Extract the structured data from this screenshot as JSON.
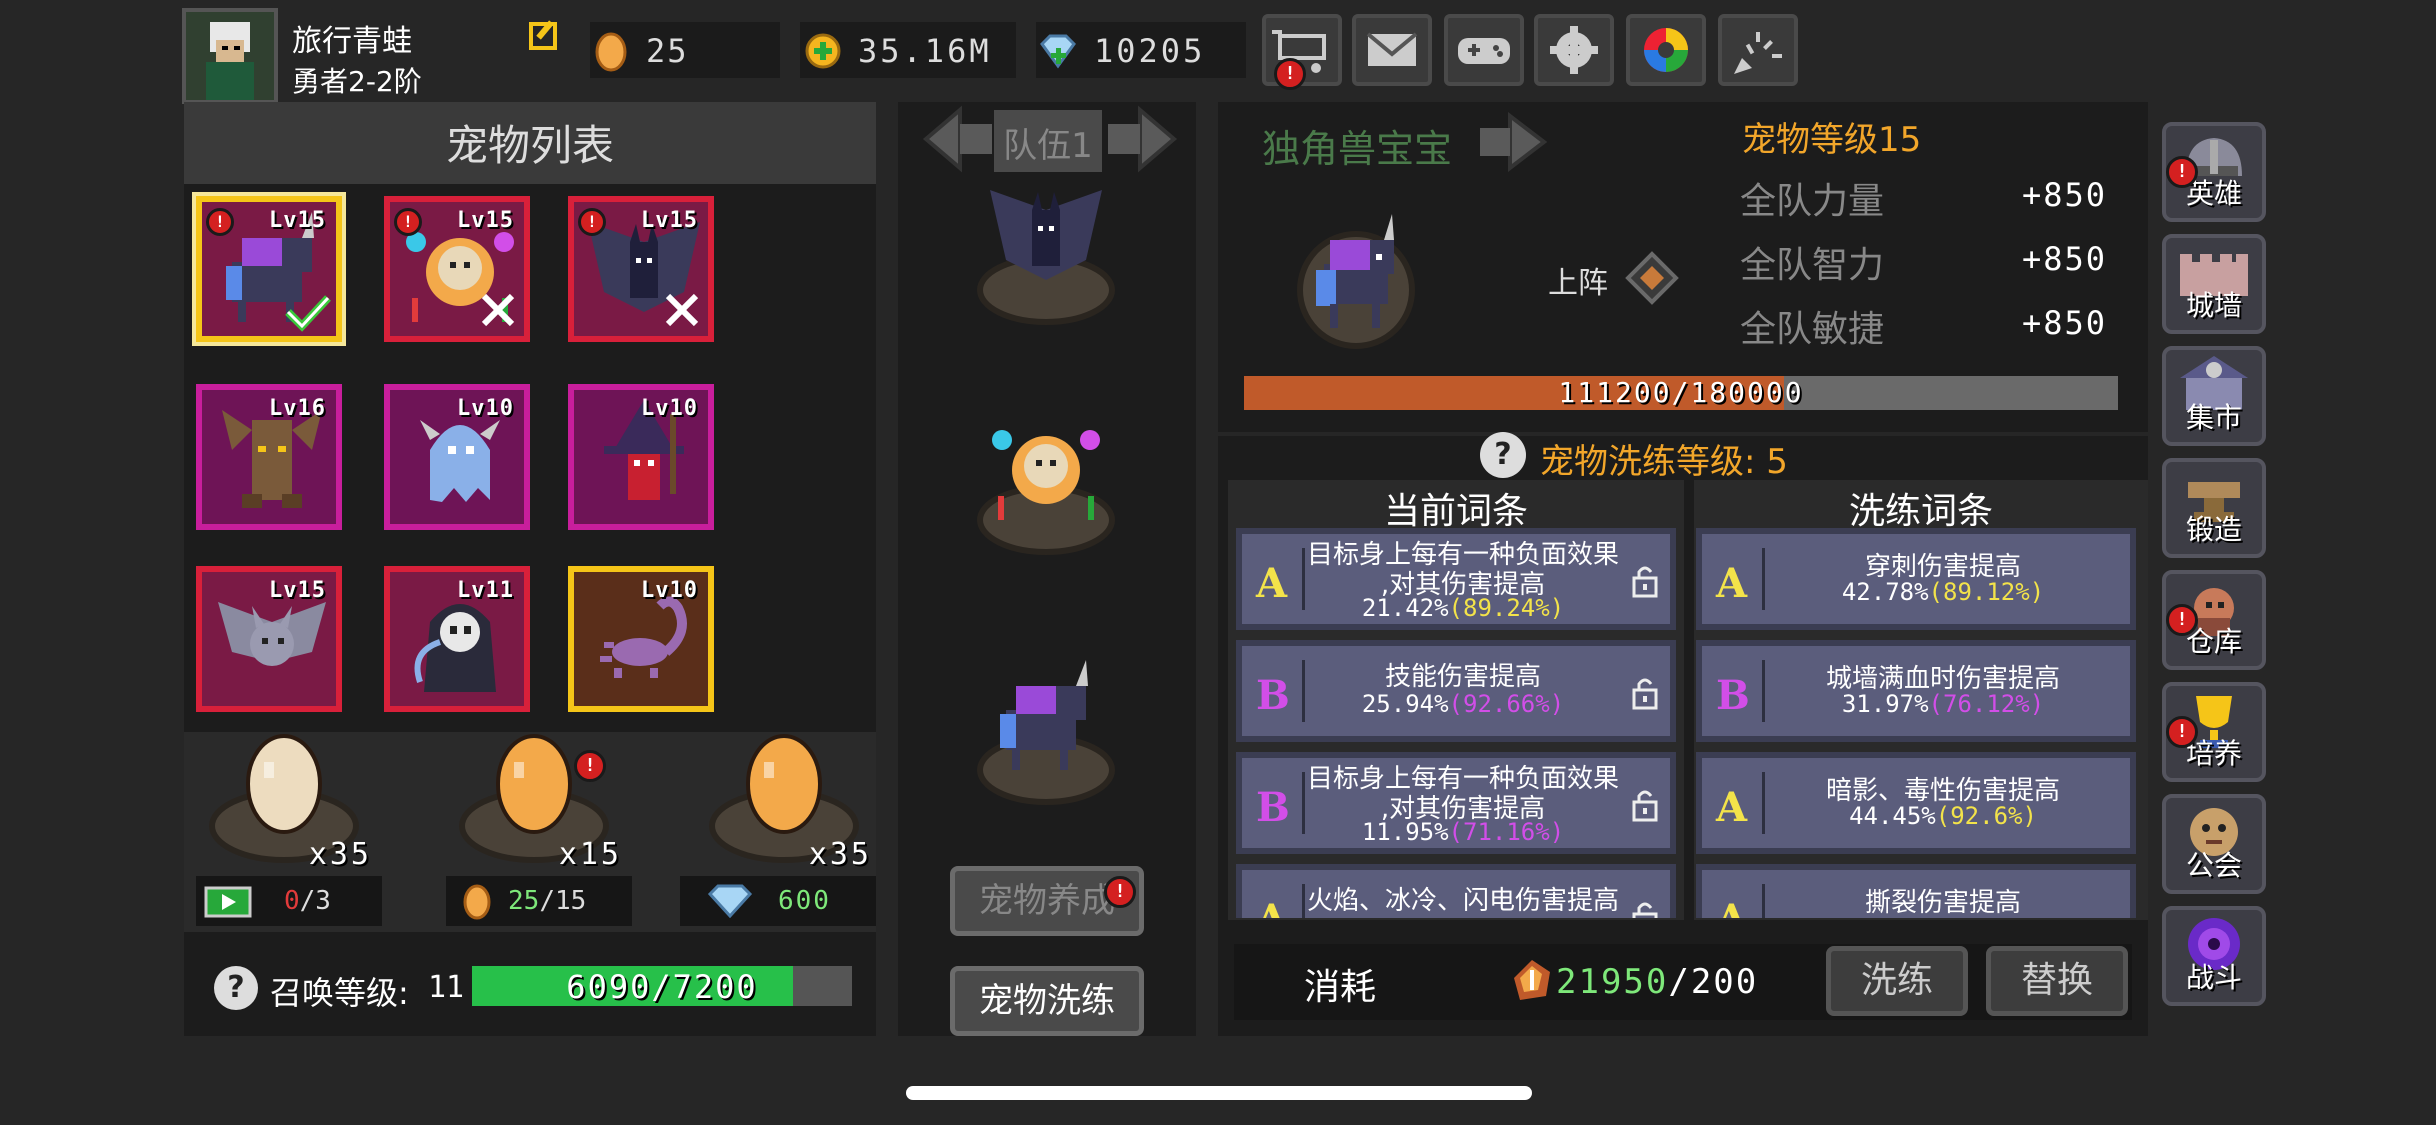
{
  "player": {
    "name": "旅行青蛙",
    "rank": "勇者2-2阶"
  },
  "currency": {
    "eggs": "25",
    "gold": "35.16M",
    "diamonds": "10205"
  },
  "top_icons": [
    "cart-icon",
    "mail-icon",
    "gamepad-icon",
    "settings-icon",
    "color-wheel-icon",
    "fireworks-icon"
  ],
  "pet_list": {
    "title": "宠物列表",
    "pets": [
      {
        "level": "Lv15",
        "name": "unicorn-pet",
        "border": "#f5c518",
        "bg": "#7a1a45",
        "alert": true,
        "state": "check"
      },
      {
        "level": "Lv15",
        "name": "fire-skull-pet",
        "border": "#d8203a",
        "bg": "#7a1a45",
        "alert": true,
        "state": "cross"
      },
      {
        "level": "Lv15",
        "name": "bat-demon-pet",
        "border": "#d8203a",
        "bg": "#7a1a45",
        "alert": true,
        "state": "cross"
      },
      {
        "level": "Lv16",
        "name": "treant-pet",
        "border": "#c81e9c",
        "bg": "#6e1456",
        "alert": false,
        "state": ""
      },
      {
        "level": "Lv10",
        "name": "ghost-pet",
        "border": "#c81e9c",
        "bg": "#6e1456",
        "alert": false,
        "state": ""
      },
      {
        "level": "Lv10",
        "name": "witch-pet",
        "border": "#c81e9c",
        "bg": "#6e1456",
        "alert": false,
        "state": ""
      },
      {
        "level": "Lv15",
        "name": "bat-pet",
        "border": "#d8203a",
        "bg": "#7a1a45",
        "alert": false,
        "state": ""
      },
      {
        "level": "Lv11",
        "name": "reaper-pet",
        "border": "#d8203a",
        "bg": "#7a1a45",
        "alert": false,
        "state": ""
      },
      {
        "level": "Lv10",
        "name": "scorpion-pet",
        "border": "#f5c518",
        "bg": "#5a2e1a",
        "alert": false,
        "state": ""
      }
    ]
  },
  "eggs": [
    {
      "count": "x35",
      "color": "#eddcbf"
    },
    {
      "count": "x15",
      "color": "#f3a94a",
      "alert": true
    },
    {
      "count": "x35",
      "color": "#f3a94a"
    }
  ],
  "costs": [
    {
      "value": "0",
      "max": "/3"
    },
    {
      "value": "25",
      "max": "/15"
    },
    {
      "value": "600",
      "max": ""
    }
  ],
  "summon": {
    "label": "召唤等级:",
    "level": "11",
    "progress": "6090/7200",
    "fraction": 0.8458
  },
  "team": {
    "title": "队伍1",
    "slots": [
      "bat-demon-pet",
      "fire-skull-pet",
      "unicorn-pet"
    ]
  },
  "team_buttons": {
    "raise": "宠物养成",
    "refine": "宠物洗练"
  },
  "pet_detail": {
    "name": "独角兽宝宝",
    "level_label": "宠物等级15",
    "deploy": "上阵",
    "stats": [
      {
        "label": "全队力量",
        "value": "+850"
      },
      {
        "label": "全队智力",
        "value": "+850"
      },
      {
        "label": "全队敏捷",
        "value": "+850"
      }
    ],
    "exp": "111200/180000",
    "exp_fraction": 0.6178
  },
  "refine": {
    "level_label": "宠物洗练等级:",
    "level": "5",
    "current_title": "当前词条",
    "refine_title": "洗练词条",
    "current": [
      {
        "grade": "A",
        "l1": "目标身上每有一种负面效果",
        "l1b": ",对其伤害提高",
        "value": "21.42%",
        "max": "(89.24%)",
        "color": "#f3e34a"
      },
      {
        "grade": "B",
        "l1": "技能伤害提高",
        "l1b": "",
        "value": "25.94%",
        "max": "(92.66%)",
        "color": "#d24ee8"
      },
      {
        "grade": "B",
        "l1": "目标身上每有一种负面效果",
        "l1b": ",对其伤害提高",
        "value": "11.95%",
        "max": "(71.16%)",
        "color": "#d24ee8"
      },
      {
        "grade": "A",
        "l1": "火焰、冰冷、闪电伤害提高",
        "l1b": "",
        "value": "",
        "max": "",
        "color": "#f3e34a"
      }
    ],
    "new": [
      {
        "grade": "A",
        "l1": "穿刺伤害提高",
        "value": "42.78%",
        "max": "(89.12%)",
        "color": "#f3e34a"
      },
      {
        "grade": "B",
        "l1": "城墙满血时伤害提高",
        "value": "31.97%",
        "max": "(76.12%)",
        "color": "#d24ee8"
      },
      {
        "grade": "A",
        "l1": "暗影、毒性伤害提高",
        "value": "44.45%",
        "max": "(92.6%)",
        "color": "#f3e34a"
      },
      {
        "grade": "A",
        "l1": "撕裂伤害提高",
        "value": "",
        "max": "",
        "color": "#f3e34a"
      }
    ],
    "cost_label": "消耗",
    "cost_have": "21950",
    "cost_need": "/200",
    "btn_refine": "洗练",
    "btn_replace": "替换"
  },
  "side_menu": [
    {
      "label": "英雄",
      "icon": "helmet-icon",
      "alert": true
    },
    {
      "label": "城墙",
      "icon": "wall-icon",
      "alert": false
    },
    {
      "label": "集市",
      "icon": "market-icon",
      "alert": false
    },
    {
      "label": "锻造",
      "icon": "anvil-icon",
      "alert": false
    },
    {
      "label": "仓库",
      "icon": "warehouse-icon",
      "alert": true
    },
    {
      "label": "培养",
      "icon": "trophy-icon",
      "alert": true
    },
    {
      "label": "公会",
      "icon": "guild-icon",
      "alert": false
    },
    {
      "label": "战斗",
      "icon": "portal-icon",
      "alert": false
    }
  ]
}
